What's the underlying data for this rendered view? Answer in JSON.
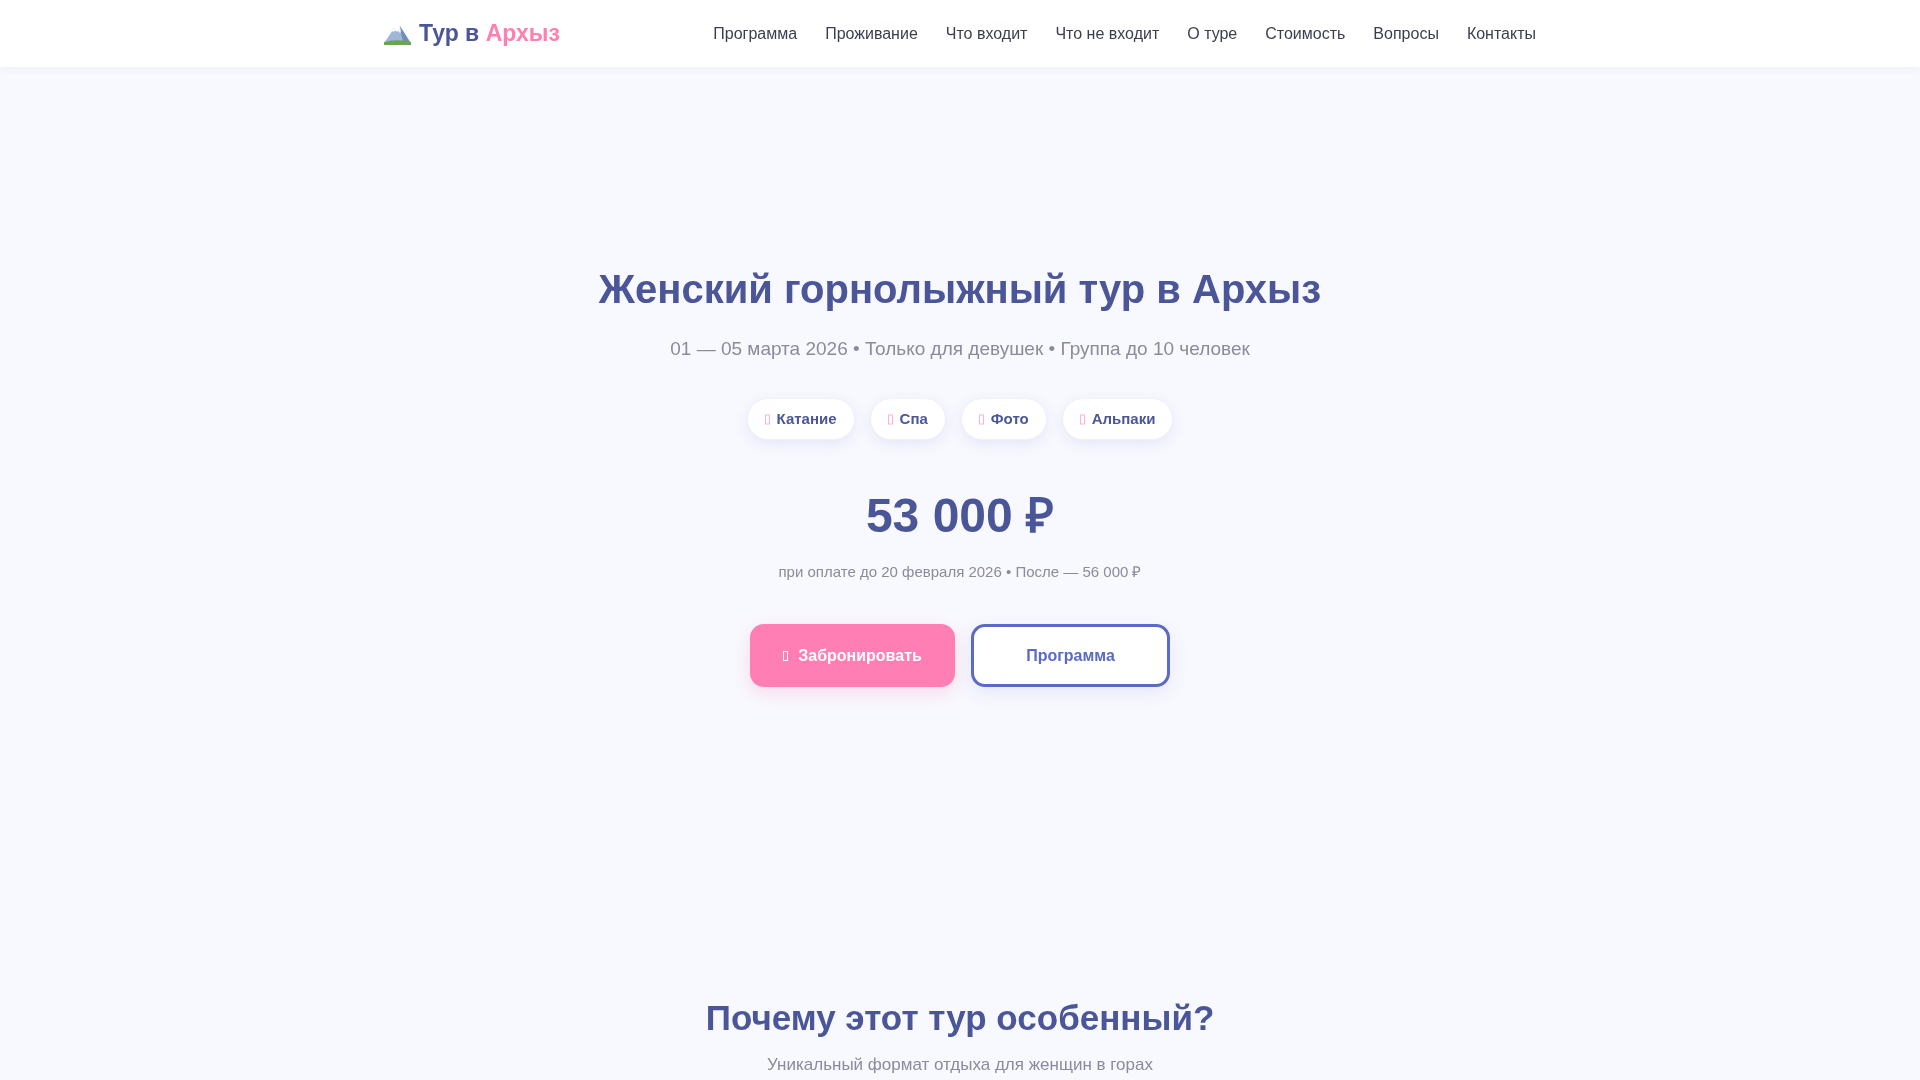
{
  "header": {
    "logo": {
      "text": "Тур в",
      "accent": "Архыз"
    },
    "nav": [
      "Программа",
      "Проживание",
      "Что входит",
      "Что не входит",
      "О туре",
      "Стоимость",
      "Вопросы",
      "Контакты"
    ]
  },
  "hero": {
    "title": "Женский горнолыжный тур в Архыз",
    "subtitle": "01 — 05 марта 2026 • Только для девушек • Группа до 10 человек",
    "tags": [
      "Катание",
      "Спа",
      "Фото",
      "Альпаки"
    ],
    "price": "53 000 ₽",
    "price_note": "при оплате до 20 февраля 2026 • После — 56 000 ₽",
    "buttons": [
      {
        "label": "Забронировать",
        "kind": "primary"
      },
      {
        "label": "Программа",
        "kind": "outline"
      }
    ]
  },
  "features": {
    "title": "Почему этот тур особенный?",
    "subtitle": "Уникальный формат отдыха для женщин в горах"
  }
}
